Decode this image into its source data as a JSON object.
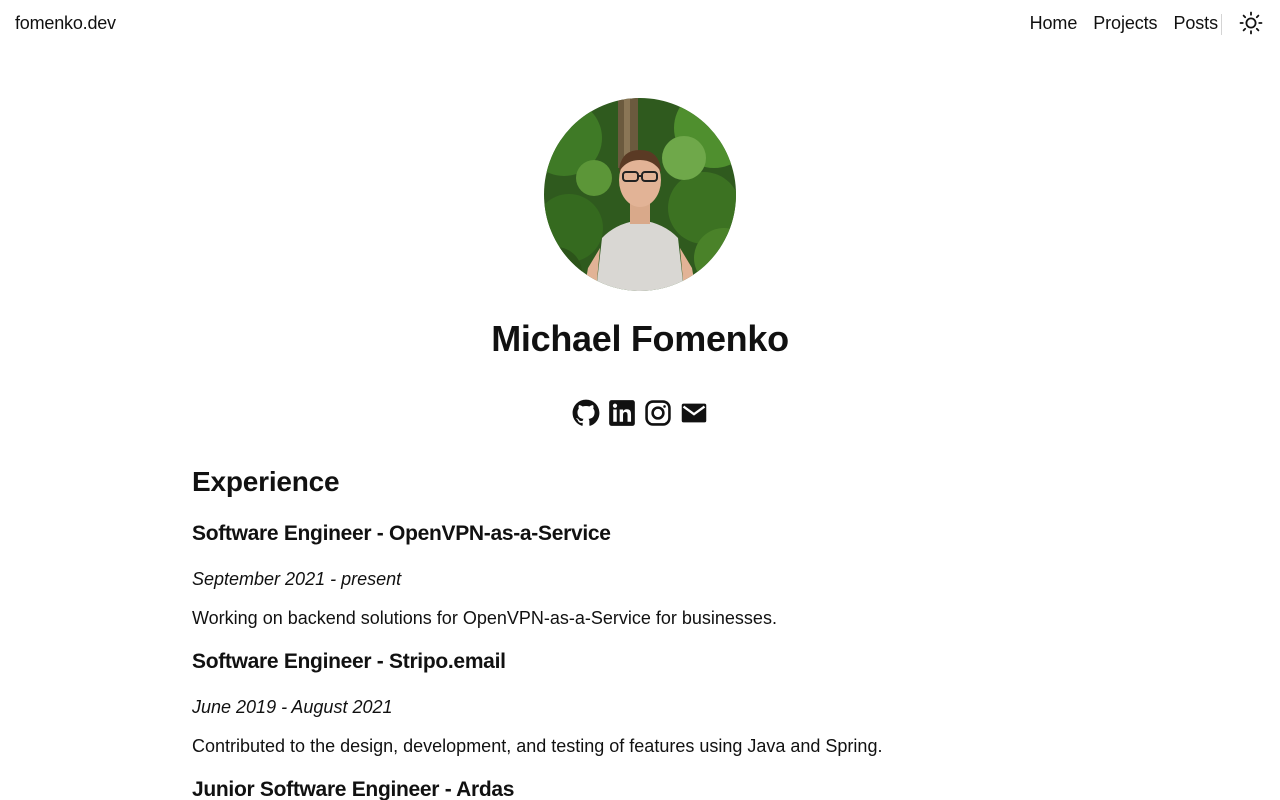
{
  "header": {
    "site_title": "fomenko.dev",
    "nav": [
      {
        "label": "Home"
      },
      {
        "label": "Projects"
      },
      {
        "label": "Posts"
      }
    ],
    "theme_toggle_icon": "sun-icon"
  },
  "profile": {
    "name": "Michael Fomenko",
    "avatar_icon": "profile-photo",
    "socials": [
      {
        "icon": "github-icon"
      },
      {
        "icon": "linkedin-icon"
      },
      {
        "icon": "instagram-icon"
      },
      {
        "icon": "mail-icon"
      }
    ]
  },
  "experience": {
    "title": "Experience",
    "jobs": [
      {
        "title": "Software Engineer - OpenVPN-as-a-Service",
        "dates": "September 2021 - present",
        "description": "Working on backend solutions for OpenVPN-as-a-Service for businesses."
      },
      {
        "title": "Software Engineer - Stripo.email",
        "dates": "June 2019 - August 2021",
        "description": "Contributed to the design, development, and testing of features using Java and Spring."
      },
      {
        "title": "Junior Software Engineer - Ardas",
        "dates": "",
        "description": ""
      }
    ]
  },
  "colors": {
    "text": "#111111",
    "background": "#ffffff",
    "divider": "#d4d4d4"
  }
}
